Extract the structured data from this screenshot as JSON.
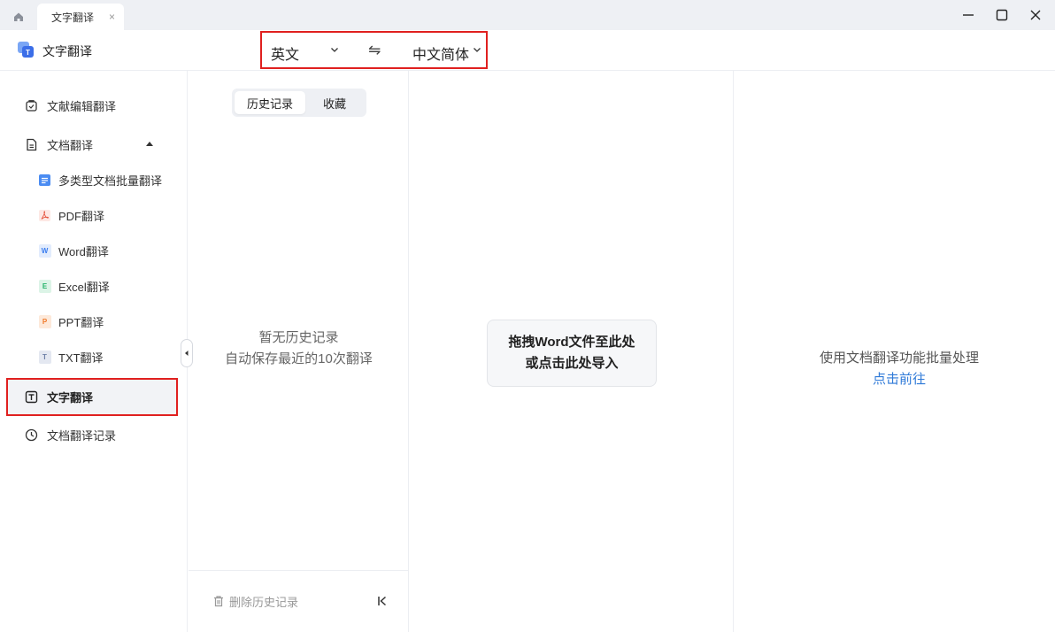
{
  "titlebar": {
    "home_icon": "home-icon",
    "tab_label": "文字翻译",
    "tab_close": "×",
    "window_controls": [
      "minimize-icon",
      "maximize-icon",
      "close-icon"
    ]
  },
  "header": {
    "app_title": "文字翻译",
    "source_lang": "英文",
    "swap_glyph": "⇋",
    "target_lang": "中文简体"
  },
  "sidebar": {
    "items": [
      {
        "label": "文献编辑翻译",
        "icon": "document-edit-icon"
      },
      {
        "label": "文档翻译",
        "icon": "document-icon"
      },
      {
        "label": "多类型文档批量翻译",
        "icon": "batch-doc-icon"
      },
      {
        "label": "PDF翻译",
        "icon": "pdf-icon"
      },
      {
        "label": "Word翻译",
        "icon": "word-icon",
        "badge": "W"
      },
      {
        "label": "Excel翻译",
        "icon": "excel-icon",
        "badge": "E"
      },
      {
        "label": "PPT翻译",
        "icon": "ppt-icon",
        "badge": "P"
      },
      {
        "label": "TXT翻译",
        "icon": "txt-icon",
        "badge": "T"
      },
      {
        "label": "文字翻译",
        "icon": "text-translate-icon"
      },
      {
        "label": "文档翻译记录",
        "icon": "clock-icon"
      }
    ]
  },
  "history": {
    "tabs": [
      "历史记录",
      "收藏"
    ],
    "empty_line1": "暂无历史记录",
    "empty_line2": "自动保存最近的10次翻译",
    "delete_label": "删除历史记录"
  },
  "dropzone": {
    "line1": "拖拽Word文件至此处",
    "line2": "或点击此处导入"
  },
  "right": {
    "hint": "使用文档翻译功能批量处理",
    "link": "点击前往"
  },
  "colors": {
    "accent_link": "#2f7ad8",
    "highlight_frame": "#e0201f",
    "pdf": "#e5533d",
    "word": "#3a7df0",
    "excel": "#26b36b",
    "ppt": "#f07a2a",
    "txt": "#6d7fa6"
  }
}
